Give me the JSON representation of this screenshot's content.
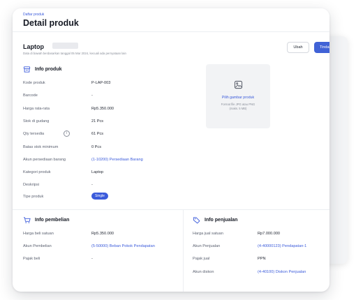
{
  "breadcrumb": "Daftar produk",
  "page_title": "Detail produk",
  "product": {
    "name": "Laptop",
    "note": "Data di bawah berdasarkan tanggal 05 Mar 2024, kecuali ada pernyataan lain"
  },
  "actions": {
    "edit": "Ubah",
    "more": "Tindak"
  },
  "info_produk": {
    "title": "Info produk",
    "rows": [
      {
        "label": "Kode produk",
        "value": "P-LAP-003"
      },
      {
        "label": "Barcode",
        "value": "-"
      },
      {
        "label": "Harga rata-rata",
        "value": "Rp5.350.000"
      },
      {
        "label": "Stok di gudang",
        "value": "21 Pcs"
      },
      {
        "label": "Qty tersedia",
        "value": "61 Pcs"
      },
      {
        "label": "Batas stok minimum",
        "value": "0 Pcs"
      },
      {
        "label": "Akun persediaan barang",
        "value": "(1-10200) Persediaan Barang"
      },
      {
        "label": "Kategori produk",
        "value": "Laptop"
      },
      {
        "label": "Deskripsi",
        "value": "-"
      },
      {
        "label": "Tipe produk",
        "value": "Single"
      }
    ]
  },
  "image_upload": {
    "title": "Pilih gambar produk",
    "hint_line1": "Format file JPG atau PNG",
    "hint_line2": "(maks. 5 MB)"
  },
  "info_pembelian": {
    "title": "Info pembelian",
    "rows": [
      {
        "label": "Harga beli satuan",
        "value": "Rp5.350.000"
      },
      {
        "label": "Akun Pembelian",
        "value": "(5-50000) Beban Pokok Pendapatan"
      },
      {
        "label": "Pajak beli",
        "value": "-"
      }
    ]
  },
  "info_penjualan": {
    "title": "Info penjualan",
    "rows": [
      {
        "label": "Harga jual satuan",
        "value": "Rp7.000.000"
      },
      {
        "label": "Akun Penjualan",
        "value": "(4-40000123) Pendapatan-1"
      },
      {
        "label": "Pajak jual",
        "value": "PPN"
      },
      {
        "label": "Akun diskon",
        "value": "(4-40100) Diskon Penjualan"
      }
    ]
  },
  "colors": {
    "accent": "#3b5bdb",
    "button_primary": "#4062d6"
  },
  "icons": {
    "product": "box-icon",
    "purchase": "cart-icon",
    "sales": "tag-icon",
    "image": "image-icon",
    "info": "info-icon"
  }
}
